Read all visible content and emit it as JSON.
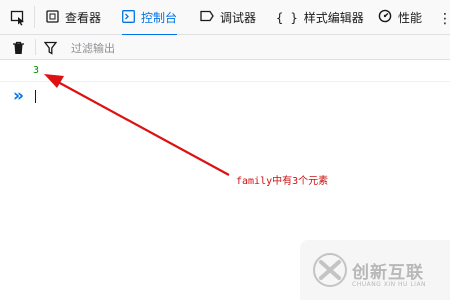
{
  "toolbar": {
    "tabs": [
      {
        "label": "查看器",
        "icon": "inspector-icon"
      },
      {
        "label": "控制台",
        "icon": "console-icon",
        "selected": true
      },
      {
        "label": "调试器",
        "icon": "debugger-icon"
      },
      {
        "label": "样式编辑器",
        "icon": "style-editor-icon"
      },
      {
        "label": "性能",
        "icon": "performance-icon"
      }
    ]
  },
  "filter": {
    "placeholder": "过滤输出"
  },
  "console": {
    "output": [
      "3"
    ],
    "prompt_symbol": "»"
  },
  "annotation": {
    "text": "family中有3个元素",
    "color": "#cc1111"
  },
  "watermark": {
    "name": "创新互联",
    "subtitle": "CHUANG XIN HU LIAN"
  },
  "colors": {
    "accent": "#0074e8",
    "log_number": "#058b00"
  }
}
